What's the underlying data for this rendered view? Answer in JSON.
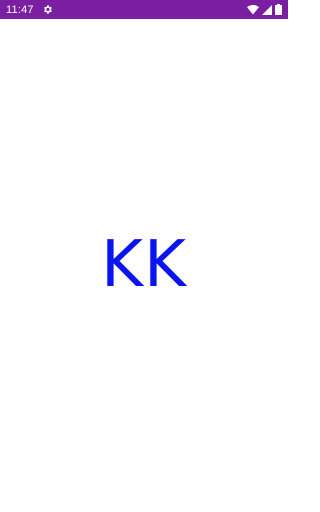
{
  "status_bar": {
    "time": "11:47",
    "background_color": "#7b1fa2",
    "icons": [
      "settings-gear-icon",
      "wifi-icon",
      "cell-signal-icon",
      "battery-icon"
    ]
  },
  "splash": {
    "title": "KK",
    "title_color": "#0a14f0",
    "background_color": "#ffffff"
  }
}
